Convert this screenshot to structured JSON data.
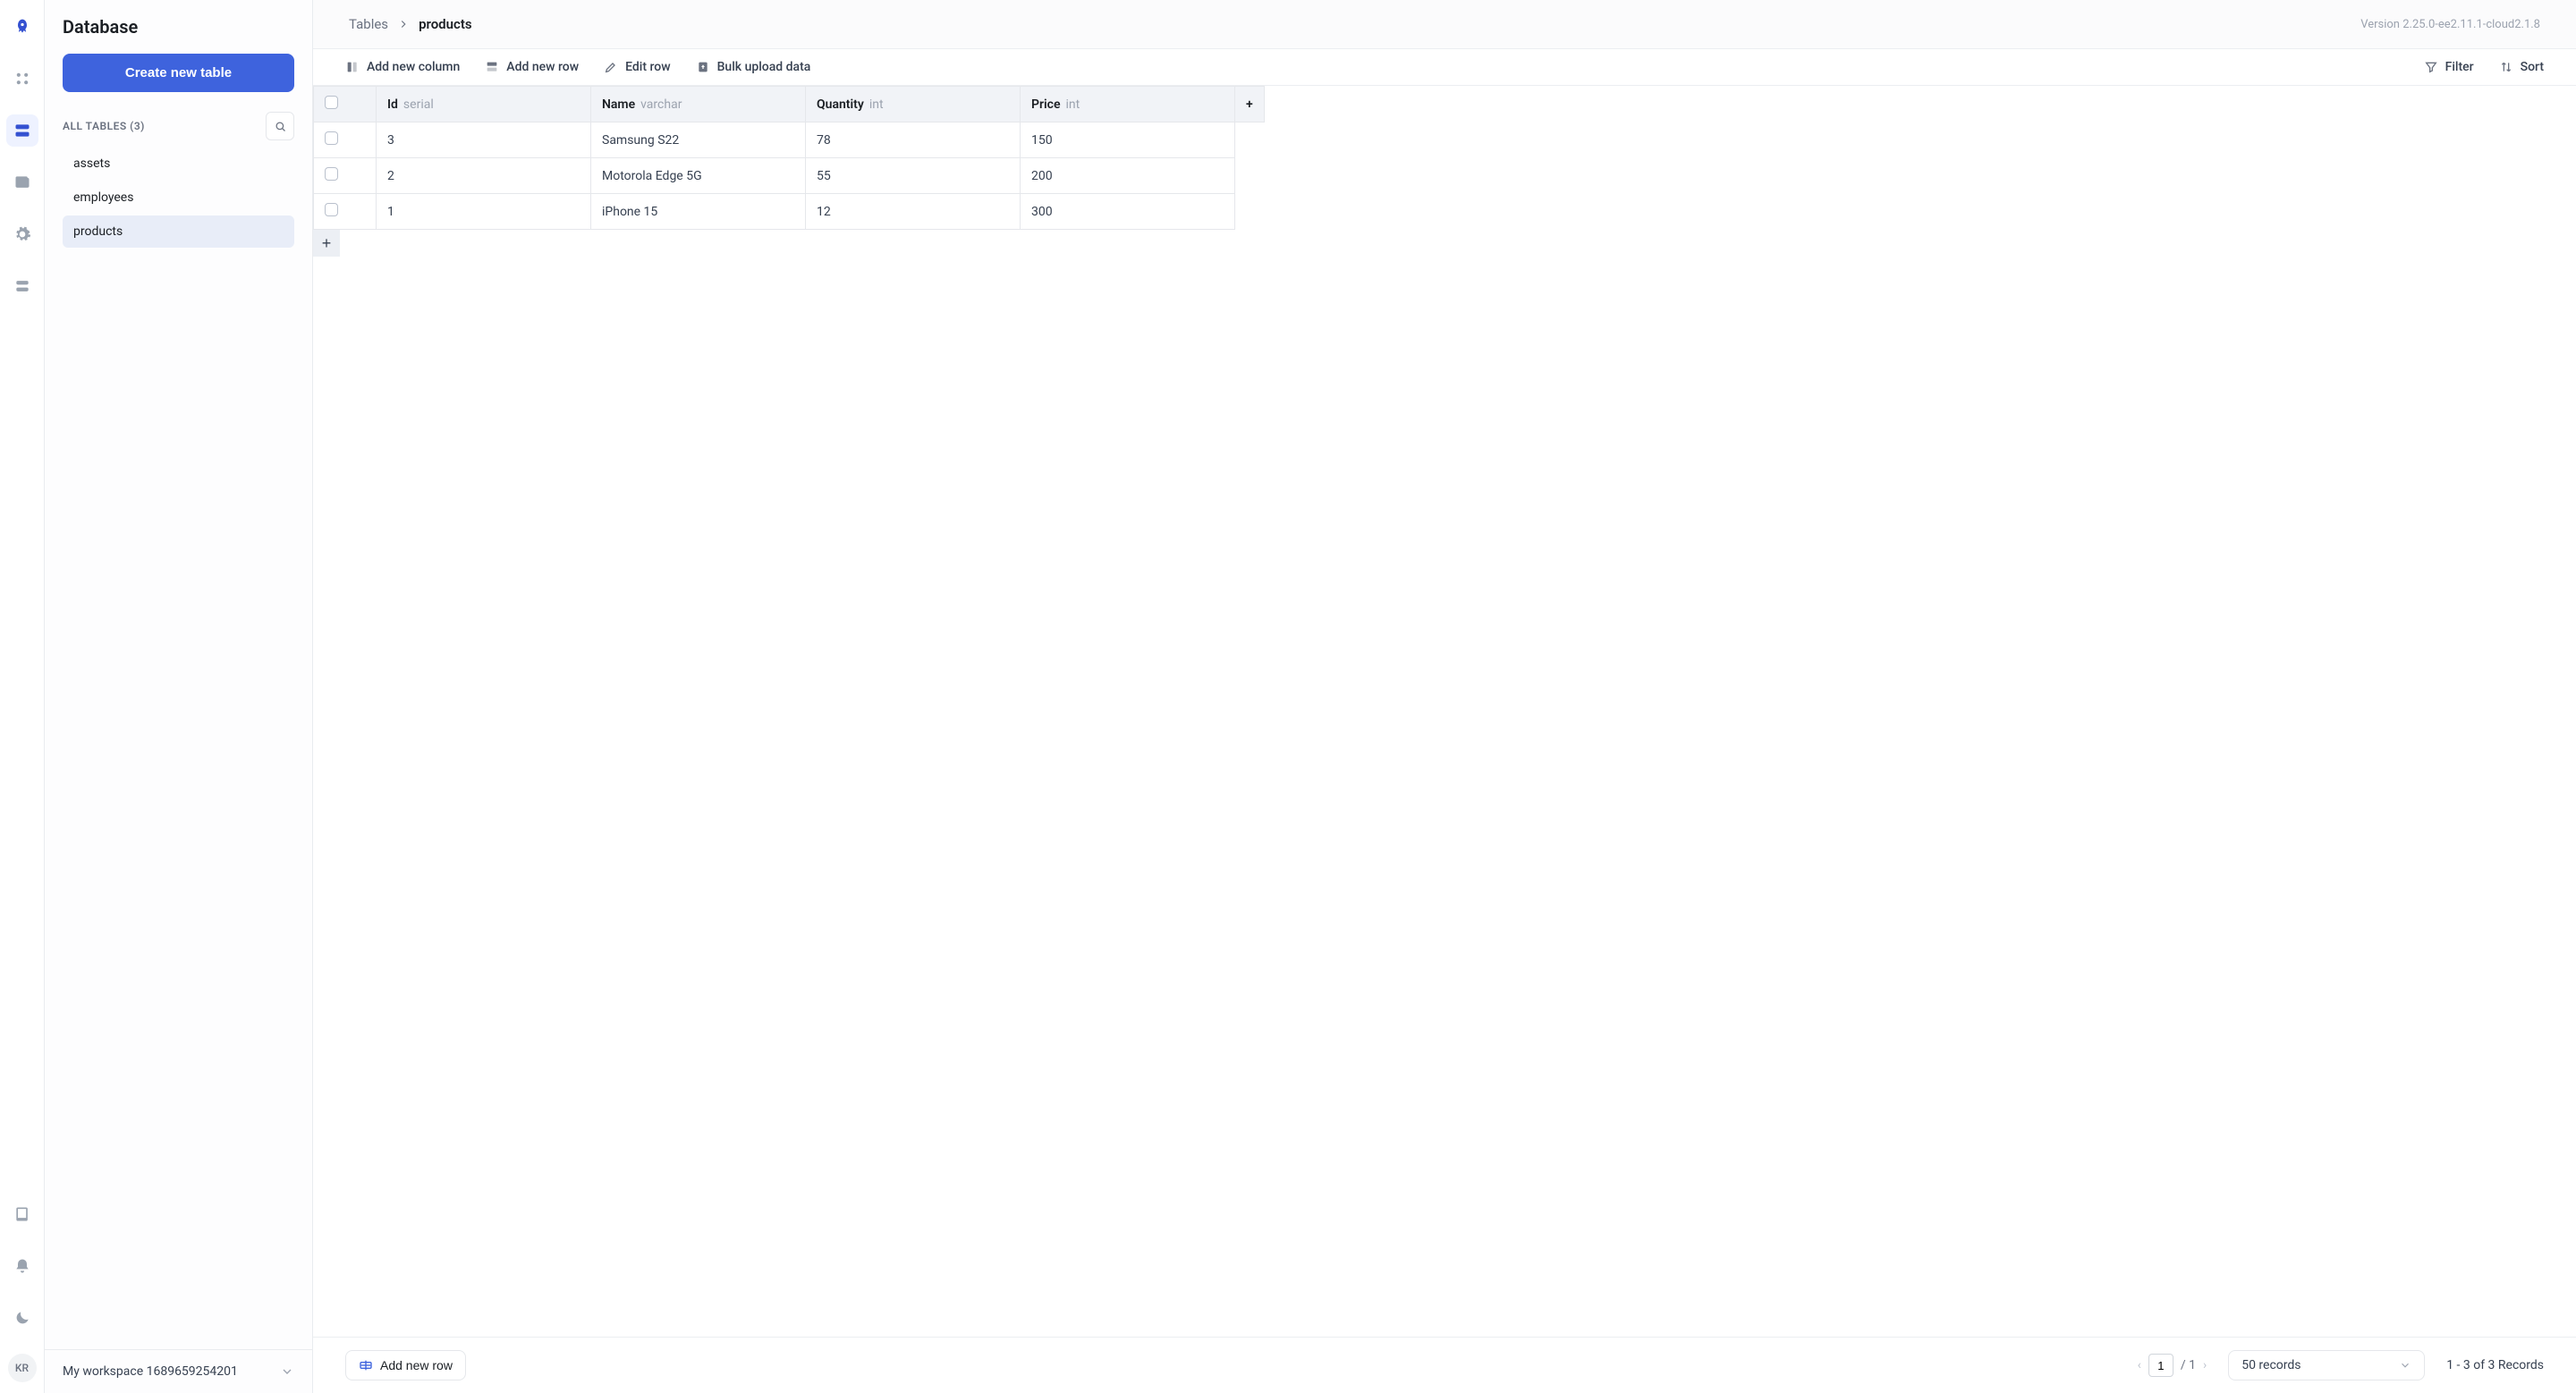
{
  "rail": {
    "avatar_initials": "KR"
  },
  "sidebar": {
    "title": "Database",
    "create_label": "Create new table",
    "all_tables_label": "ALL TABLES (3)",
    "tables": [
      {
        "name": "assets",
        "selected": false
      },
      {
        "name": "employees",
        "selected": false
      },
      {
        "name": "products",
        "selected": true
      }
    ],
    "workspace": "My workspace 1689659254201"
  },
  "topbar": {
    "breadcrumb_root": "Tables",
    "breadcrumb_current": "products",
    "version": "Version 2.25.0-ee2.11.1-cloud2.1.8"
  },
  "toolbar": {
    "add_column": "Add new column",
    "add_row": "Add new row",
    "edit_row": "Edit row",
    "bulk_upload": "Bulk upload data",
    "filter": "Filter",
    "sort": "Sort"
  },
  "table": {
    "columns": [
      {
        "name": "Id",
        "type": "serial"
      },
      {
        "name": "Name",
        "type": "varchar"
      },
      {
        "name": "Quantity",
        "type": "int"
      },
      {
        "name": "Price",
        "type": "int"
      }
    ],
    "rows": [
      {
        "Id": "3",
        "Name": "Samsung S22",
        "Quantity": "78",
        "Price": "150"
      },
      {
        "Id": "2",
        "Name": "Motorola Edge 5G",
        "Quantity": "55",
        "Price": "200"
      },
      {
        "Id": "1",
        "Name": "iPhone 15",
        "Quantity": "12",
        "Price": "300"
      }
    ],
    "add_col_glyph": "+",
    "add_row_glyph": "+"
  },
  "footer": {
    "add_row": "Add new row",
    "page_input": "1",
    "page_total": "/ 1",
    "page_size": "50 records",
    "records_info": "1 - 3 of 3 Records"
  }
}
